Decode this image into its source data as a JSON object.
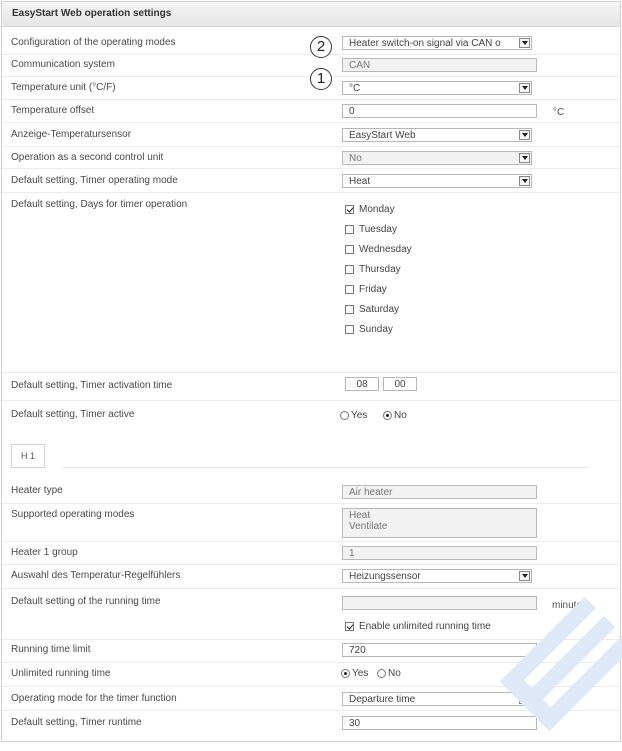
{
  "panel": {
    "title": "EasyStart Web operation settings"
  },
  "callouts": {
    "first": "2",
    "second": "1"
  },
  "rows": {
    "op_modes": {
      "label": "Configuration of the operating modes",
      "value": "Heater switch-on signal via CAN o"
    },
    "comm": {
      "label": "Communication system",
      "value": "CAN"
    },
    "temp_unit": {
      "label": "Temperature unit (°C/F)",
      "value": "°C"
    },
    "temp_offset": {
      "label": "Temperature offset",
      "value": "0",
      "unit": "°C"
    },
    "anzeige": {
      "label": "Anzeige-Temperatursensor",
      "value": "EasyStart Web"
    },
    "second_unit": {
      "label": "Operation as a second control unit",
      "value": "No"
    },
    "timer_mode": {
      "label": "Default setting, Timer operating mode",
      "value": "Heat"
    },
    "timer_days": {
      "label": "Default setting, Days for timer operation",
      "days": [
        {
          "name": "Monday",
          "checked": true
        },
        {
          "name": "Tuesday",
          "checked": false
        },
        {
          "name": "Wednesday",
          "checked": false
        },
        {
          "name": "Thursday",
          "checked": false
        },
        {
          "name": "Friday",
          "checked": false
        },
        {
          "name": "Saturday",
          "checked": false
        },
        {
          "name": "Sunday",
          "checked": false
        }
      ]
    },
    "activation_time": {
      "label": "Default setting, Timer activation time",
      "hours": "08",
      "minutes": "00"
    },
    "timer_active": {
      "label": "Default setting, Timer active",
      "yes": "Yes",
      "no": "No",
      "selected": "No"
    },
    "heater_tab": "H 1",
    "heater_type": {
      "label": "Heater type",
      "value": "Air heater"
    },
    "supported_modes": {
      "label": "Supported operating modes",
      "line1": "Heat",
      "line2": "Ventilate"
    },
    "heater_group": {
      "label": "Heater 1 group",
      "value": "1"
    },
    "regelfuehler": {
      "label": "Auswahl des Temperatur-Regelfühlers",
      "value": "Heizungssensor"
    },
    "running_time": {
      "label": "Default setting of the running time",
      "value": "",
      "unit": "minutes",
      "checkbox": "Enable unlimited running time",
      "checked": true
    },
    "running_limit": {
      "label": "Running time limit",
      "value": "720"
    },
    "unlimited": {
      "label": "Unlimited running time",
      "yes": "Yes",
      "no": "No",
      "selected": "Yes"
    },
    "timer_function": {
      "label": "Operating mode for the timer function",
      "value": "Departure time"
    },
    "timer_runtime": {
      "label": "Default setting, Timer runtime",
      "value": "30"
    }
  },
  "colors": {
    "watermark": "#dfe8f6",
    "border": "#b8b8b8"
  }
}
